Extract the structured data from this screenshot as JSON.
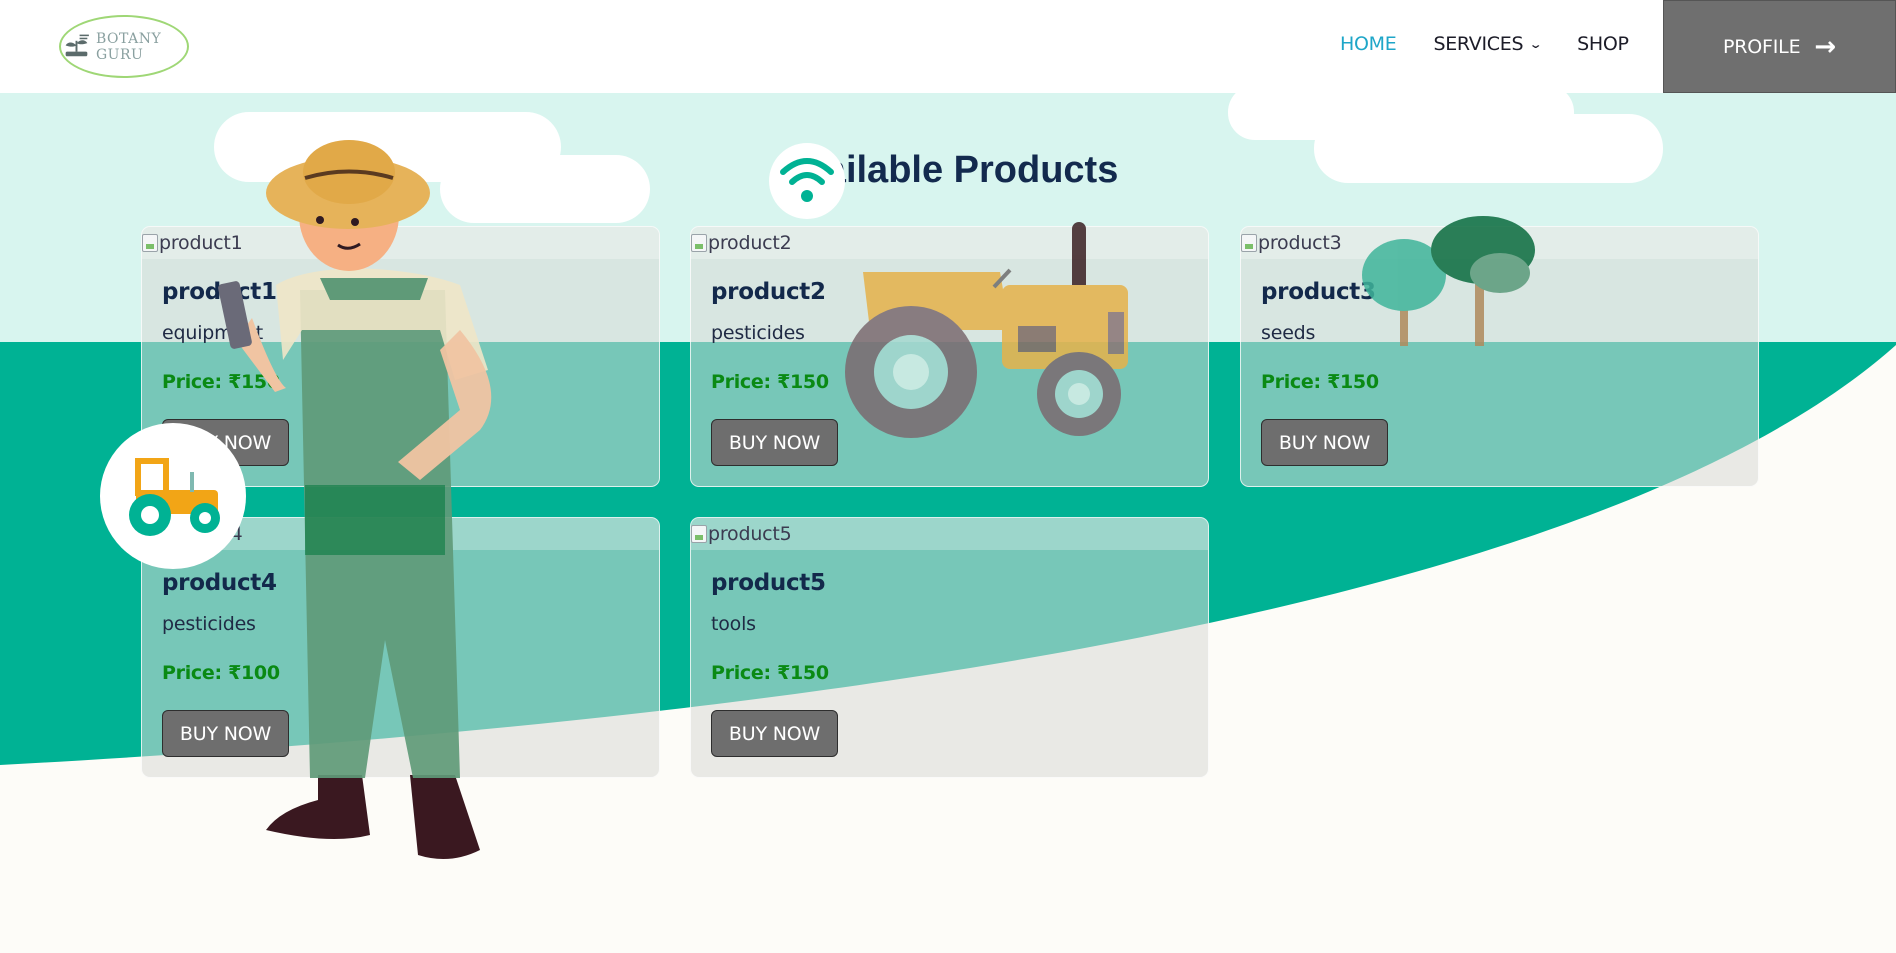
{
  "header": {
    "logo_text": "BOTANY GURU",
    "nav": [
      {
        "label": "HOME",
        "active": true
      },
      {
        "label": "SERVICES",
        "dropdown": true
      },
      {
        "label": "SHOP",
        "active": false
      }
    ],
    "profile_label": "PROFILE"
  },
  "main": {
    "title": "Available Products",
    "products": [
      {
        "alt": "product1",
        "name": "product1",
        "category": "equipment",
        "price": "Price: ₹150",
        "button": "BUY NOW"
      },
      {
        "alt": "product2",
        "name": "product2",
        "category": "pesticides",
        "price": "Price: ₹150",
        "button": "BUY NOW"
      },
      {
        "alt": "product3",
        "name": "product3",
        "category": "seeds",
        "price": "Price: ₹150",
        "button": "BUY NOW"
      },
      {
        "alt": "product4",
        "name": "product4",
        "category": "pesticides",
        "price": "Price: ₹100",
        "button": "BUY NOW"
      },
      {
        "alt": "product5",
        "name": "product5",
        "category": "tools",
        "price": "Price: ₹150",
        "button": "BUY NOW"
      }
    ]
  },
  "colors": {
    "accent": "#1ea6c8",
    "teal": "#00b294",
    "mint": "#d8f5ef",
    "price": "#0a8a14",
    "title": "#132a4e",
    "button": "#6e6e6e"
  },
  "icons": [
    "arrow-right-icon",
    "chevron-down-icon",
    "broken-image-icon",
    "logo-plant-icon"
  ]
}
